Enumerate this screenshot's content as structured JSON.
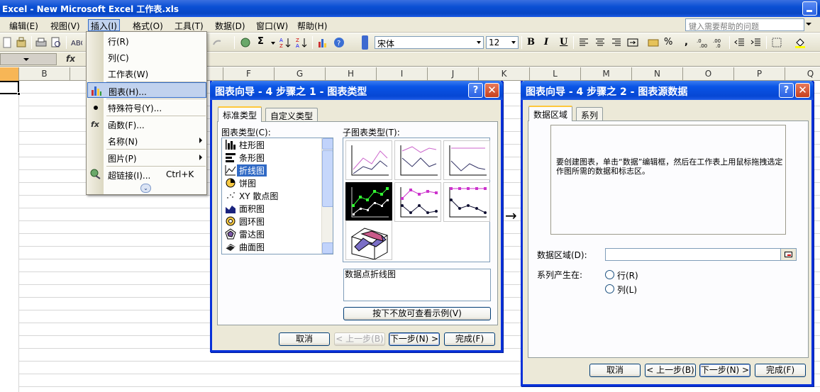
{
  "window": {
    "title": "Excel - New Microsoft Excel 工作表.xls"
  },
  "menubar": {
    "items": [
      "编辑(E)",
      "视图(V)",
      "插入(I)",
      "格式(O)",
      "工具(T)",
      "数据(D)",
      "窗口(W)",
      "帮助(H)"
    ],
    "help_placeholder": "键入需要帮助的问题"
  },
  "toolbar": {
    "font_name": "宋体",
    "font_size": "12",
    "bold": "B",
    "italic": "I",
    "underline": "U",
    "sigma": "Σ",
    "percent": "%",
    "comma": ","
  },
  "formula": {
    "fx": "fx"
  },
  "columns": [
    "B",
    "F",
    "G",
    "H",
    "I",
    "J",
    "K",
    "L",
    "M",
    "N",
    "O",
    "P",
    "Q"
  ],
  "insert_menu": {
    "items": [
      {
        "label": "行(R)",
        "icon": "none"
      },
      {
        "label": "列(C)",
        "icon": "none"
      },
      {
        "label": "工作表(W)",
        "icon": "none"
      },
      {
        "label": "图表(H)...",
        "icon": "chart-icon"
      },
      {
        "label": "特殊符号(Y)...",
        "icon": "dot-icon"
      },
      {
        "label": "函数(F)...",
        "icon": "fx-icon"
      },
      {
        "label": "名称(N)",
        "icon": "none"
      },
      {
        "label": "图片(P)",
        "icon": "none"
      },
      {
        "label": "超链接(I)...",
        "icon": "link-icon",
        "shortcut": "Ctrl+K"
      }
    ]
  },
  "dialog1": {
    "title": "图表向导 - 4 步骤之 1 - 图表类型",
    "tabs": [
      "标准类型",
      "自定义类型"
    ],
    "chart_type_label": "图表类型(C):",
    "subtype_label": "子图表类型(T):",
    "chart_types": [
      {
        "name": "柱形图",
        "icon": "column-chart-icon"
      },
      {
        "name": "条形图",
        "icon": "bar-chart-icon"
      },
      {
        "name": "折线图",
        "icon": "line-chart-icon"
      },
      {
        "name": "饼图",
        "icon": "pie-chart-icon"
      },
      {
        "name": "XY 散点图",
        "icon": "scatter-chart-icon"
      },
      {
        "name": "面积图",
        "icon": "area-chart-icon"
      },
      {
        "name": "圆环图",
        "icon": "doughnut-chart-icon"
      },
      {
        "name": "雷达图",
        "icon": "radar-chart-icon"
      },
      {
        "name": "曲面图",
        "icon": "surface-chart-icon"
      }
    ],
    "selected_type": "折线图",
    "description": "数据点折线图",
    "preview_button": "按下不放可查看示例(V)",
    "buttons": {
      "cancel": "取消",
      "back": "< 上一步(B)",
      "next": "下一步(N) >",
      "finish": "完成(F)"
    }
  },
  "arrow": "→",
  "dialog2": {
    "title": "图表向导 - 4 步骤之 2 - 图表源数据",
    "tabs": [
      "数据区域",
      "系列"
    ],
    "message": "要创建图表，单击“数据”编辑框，然后在工作表上用鼠标拖拽选定作图所需的数据和标志区。",
    "range_label": "数据区域(D):",
    "range_value": "",
    "series_label": "系列产生在:",
    "radio_rows": "行(R)",
    "radio_cols": "列(L)",
    "buttons": {
      "cancel": "取消",
      "back": "< 上一步(B)",
      "next": "下一步(N) >",
      "finish": "完成(F)"
    }
  }
}
